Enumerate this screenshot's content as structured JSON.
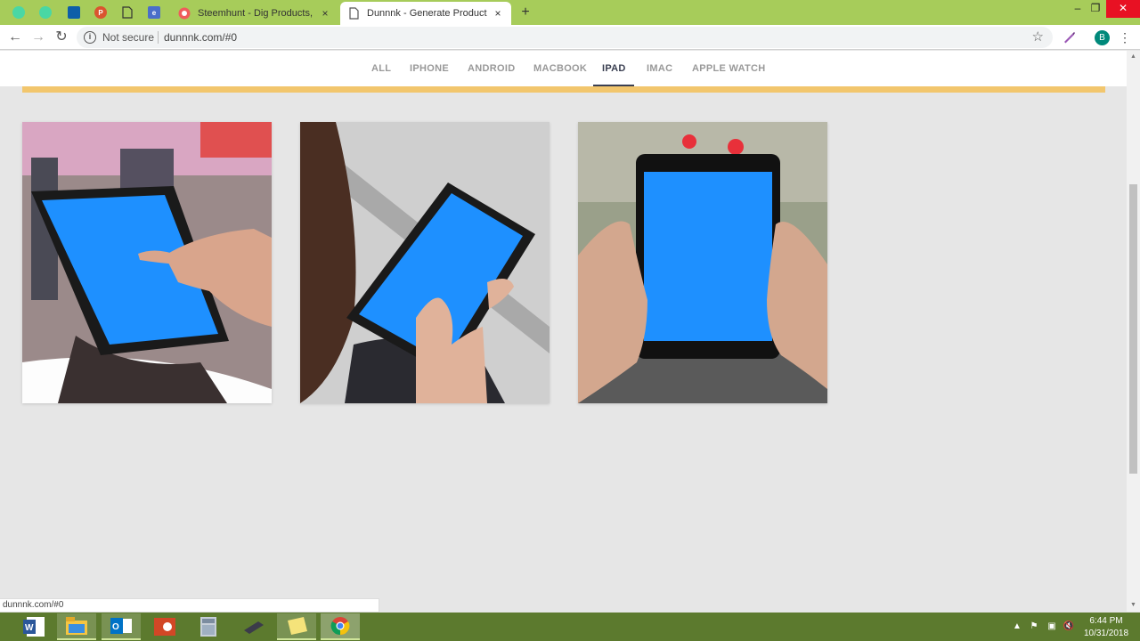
{
  "browser": {
    "tabs": [
      {
        "title": "Steemhunt - Dig Products, Earn ",
        "close": "×"
      },
      {
        "title": "Dunnnk - Generate Product Moc",
        "close": "×"
      }
    ],
    "new_tab": "+",
    "window_controls": {
      "minimize": "–",
      "restore": "❐",
      "close": "✕"
    },
    "nav": {
      "back": "←",
      "forward": "→",
      "reload": "↻"
    },
    "security_label": "Not secure",
    "url": "dunnnk.com/#0",
    "profile_initial": "B",
    "menu": "⋮",
    "star": "☆"
  },
  "filters": {
    "items": [
      "ALL",
      "IPHONE",
      "ANDROID",
      "MACBOOK",
      "IPAD",
      "IMAC",
      "APPLE WATCH"
    ],
    "active": "IPAD"
  },
  "accent_colors": {
    "band": "#f2c66d",
    "screen": "#1e90ff",
    "tabstrip": "#a7cc5a",
    "taskbar": "#5c7a2e"
  },
  "gallery": [
    {
      "icon": "ipad-mockup-icon"
    },
    {
      "icon": "ipad-mockup-icon"
    },
    {
      "icon": "ipad-mockup-icon"
    }
  ],
  "status_bar": {
    "url": "dunnnk.com/#0"
  },
  "taskbar": {
    "time": "6:44 PM",
    "date": "10/31/2018",
    "apps": [
      "word-icon",
      "file-explorer-icon",
      "outlook-icon",
      "powerpoint-icon",
      "calculator-icon",
      "vscode-icon",
      "sticky-notes-icon",
      "chrome-icon"
    ]
  }
}
